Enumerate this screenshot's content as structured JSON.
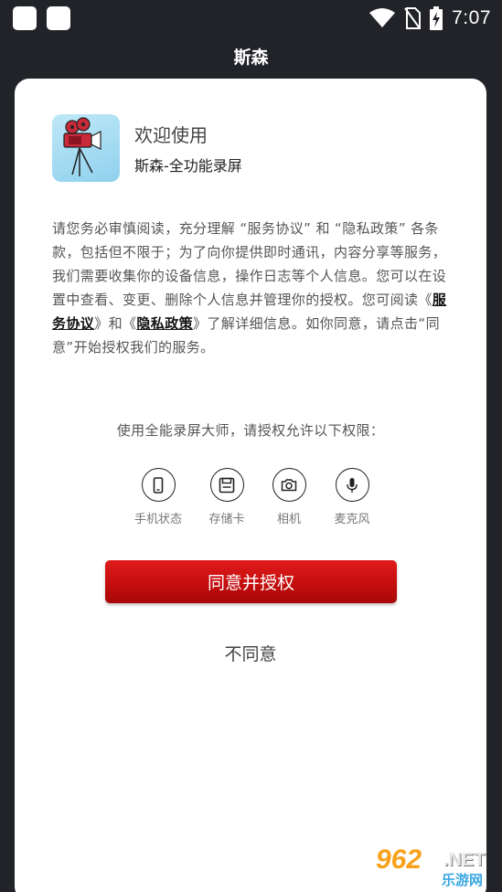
{
  "status_bar": {
    "time": "7:07",
    "icons": [
      "notification-square-icon",
      "notification-square-icon",
      "wifi-icon",
      "no-sim-icon",
      "battery-charging-icon"
    ]
  },
  "header": {
    "title": "斯森"
  },
  "dialog": {
    "welcome": "欢迎使用",
    "app_name": "斯森-全功能录屏",
    "notice_part1": "请您务必审慎阅读，充分理解 “服务协议” 和 “隐私政策” 各条款，包括但不限于；为了向你提供即时通讯，内容分享等服务，我们需要收集你的设备信息，操作日志等个人信息。您可以在设置中查看、变更、删除个人信息并管理你的授权。您可阅读《",
    "link_service": "服务协议",
    "notice_part2": "》和《",
    "link_privacy": "隐私政策",
    "notice_part3": "》了解详细信息。如你同意，请点击“同意”开始授权我们的服务。",
    "permission_prompt": "使用全能录屏大师，请授权允许以下权限：",
    "permissions": [
      {
        "label": "手机状态",
        "icon": "phone-icon"
      },
      {
        "label": "存储卡",
        "icon": "sd-card-icon"
      },
      {
        "label": "相机",
        "icon": "camera-icon"
      },
      {
        "label": "麦克风",
        "icon": "microphone-icon"
      }
    ],
    "agree_label": "同意并授权",
    "disagree_label": "不同意"
  },
  "watermark": {
    "brand": "962",
    "suffix": ".NET",
    "sub": "乐游网"
  },
  "colors": {
    "background": "#212328",
    "accent": "#c20d0d",
    "card": "#ffffff"
  }
}
